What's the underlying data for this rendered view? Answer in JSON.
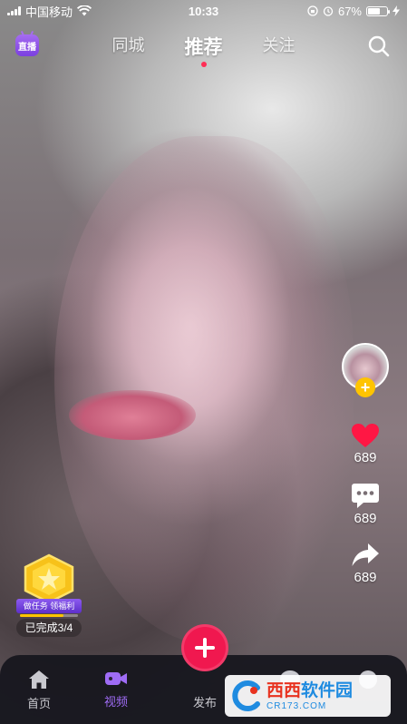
{
  "status_bar": {
    "carrier": "中国移动",
    "time": "10:33",
    "battery": "67%",
    "battery_level": 0.67
  },
  "top_nav": {
    "live_label": "直播",
    "tabs": [
      {
        "label": "同城",
        "active": false
      },
      {
        "label": "推荐",
        "active": true
      },
      {
        "label": "关注",
        "active": false
      }
    ],
    "accent_color": "#ff2d55"
  },
  "right_rail": {
    "like_count": "689",
    "comment_count": "689",
    "share_count": "689",
    "like_color": "#ff1744"
  },
  "task_badge": {
    "ribbon_text": "做任务 领福利",
    "progress_text": "已完成3/4",
    "progress_fraction": 0.75
  },
  "bottom_bar": {
    "items": [
      {
        "label": "首页",
        "icon": "home-icon",
        "active": false
      },
      {
        "label": "视频",
        "icon": "video-camera-icon",
        "active": true
      },
      {
        "label": "发布",
        "icon": "plus-icon",
        "active": false
      }
    ],
    "active_color": "#9f6cf5",
    "publish_color": "#f0184f"
  },
  "watermark": {
    "name_part1": "西西",
    "name_part2": "软件园",
    "url": "CR173.COM"
  }
}
